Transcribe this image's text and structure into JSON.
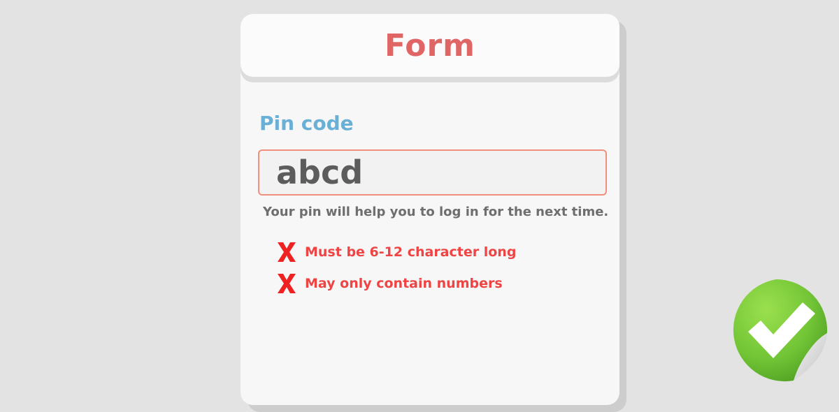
{
  "form": {
    "title": "Form",
    "field_label": "Pin code",
    "pin_value": "abcd",
    "helper_text": "Your pin will help you to log in for the next time.",
    "rules": [
      {
        "text": "Must be 6-12 character long",
        "status": "failed"
      },
      {
        "text": "May only contain numbers",
        "status": "failed"
      }
    ]
  },
  "icons": {
    "rule_status": "cross-icon",
    "sticker": "green-checkmark-sticker-icon"
  },
  "colors": {
    "title": "#e06666",
    "label": "#6aafd6",
    "error": "#ee4444",
    "input_border": "#f08f7c",
    "sticker_green": "#7ccd3a"
  }
}
